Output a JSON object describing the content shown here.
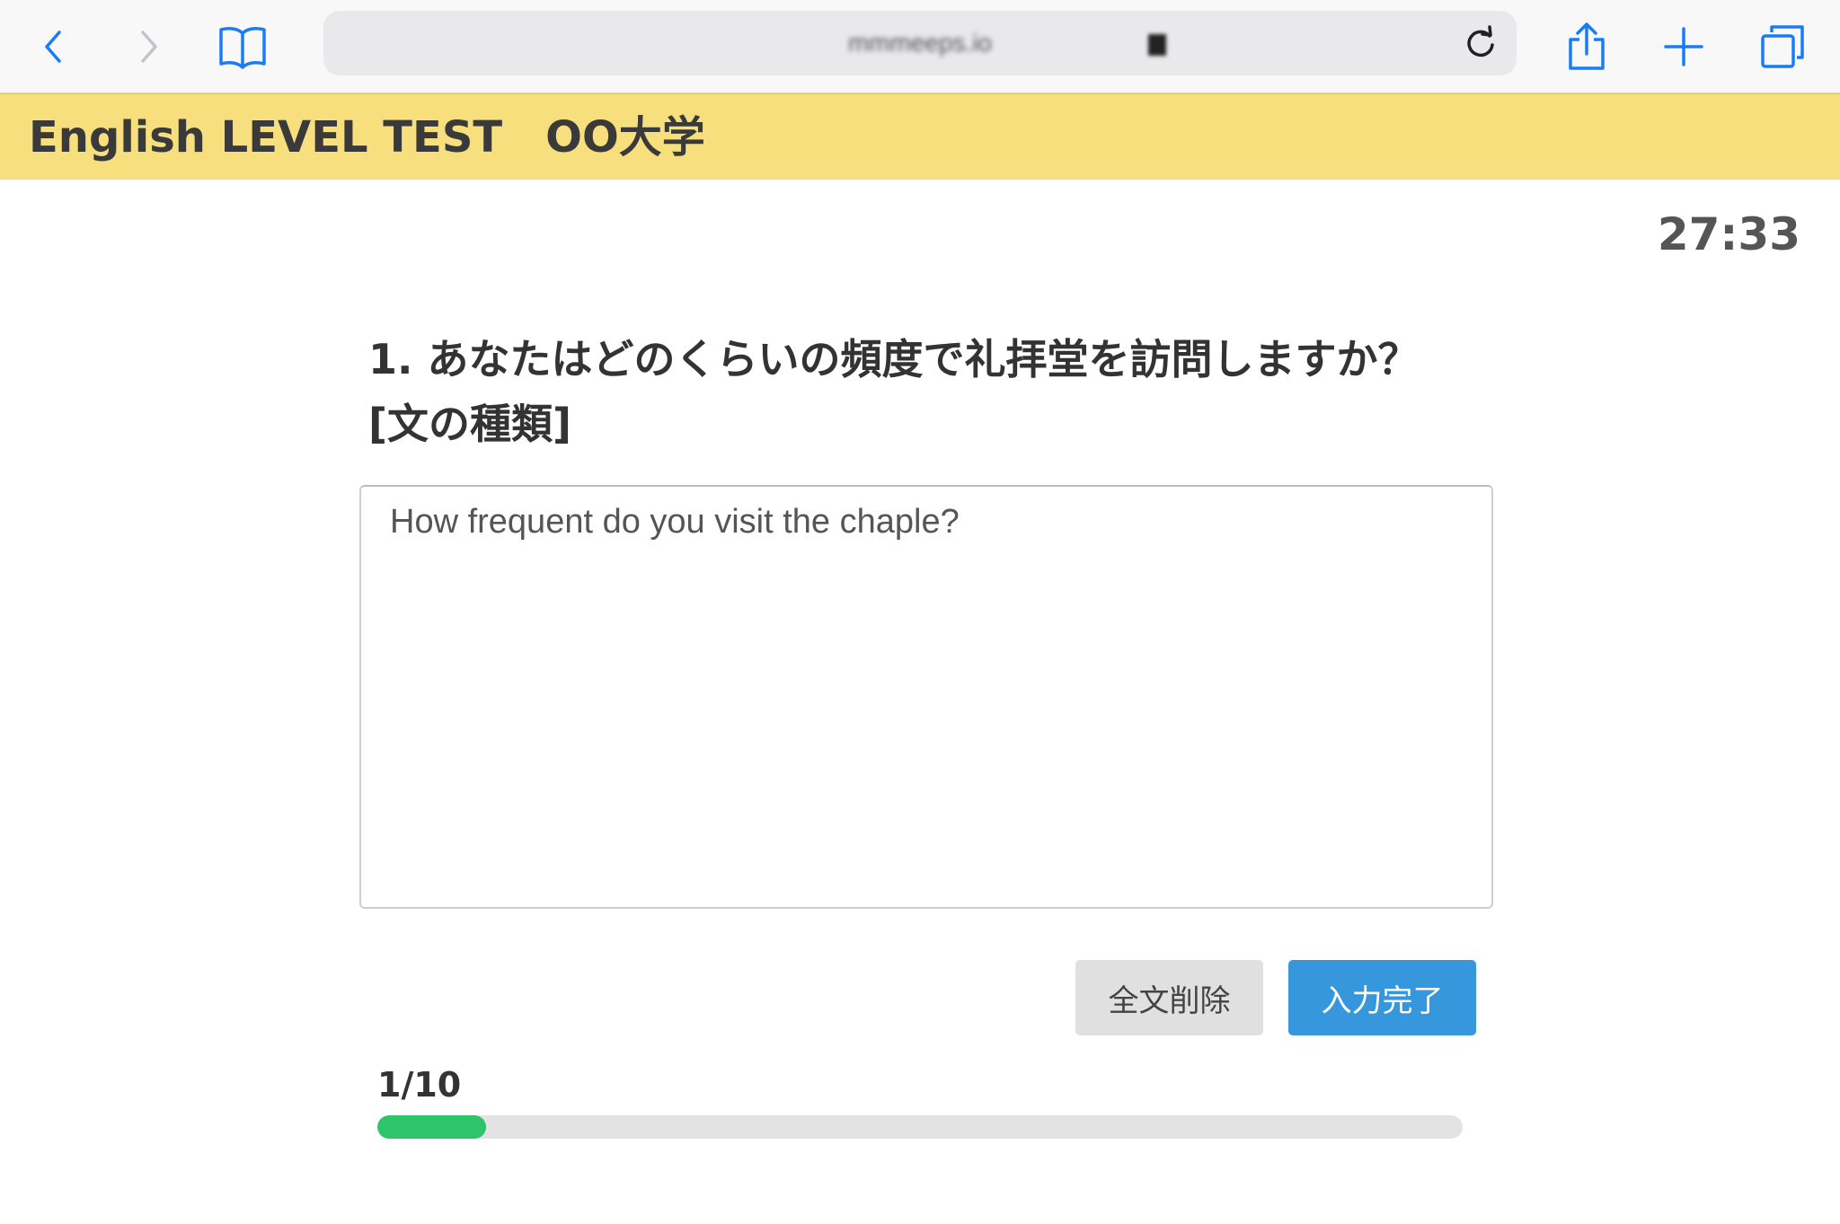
{
  "browser": {
    "address": "mmmeeps.io",
    "accent": "#1a7cf5"
  },
  "header": {
    "title": "English LEVEL TEST　OO大学",
    "background": "#f7df7e"
  },
  "timer": "27:33",
  "question": {
    "line1": "1. あなたはどのくらいの頻度で礼拝堂を訪問しますか？",
    "line2": "[文の種類]"
  },
  "answer": {
    "value": "How frequent do you visit the chaple?"
  },
  "buttons": {
    "clear_label": "全文削除",
    "done_label": "入力完了",
    "done_color": "#3797dd"
  },
  "progress": {
    "label": "1/10",
    "current": 1,
    "total": 10,
    "color": "#2ec56a"
  }
}
